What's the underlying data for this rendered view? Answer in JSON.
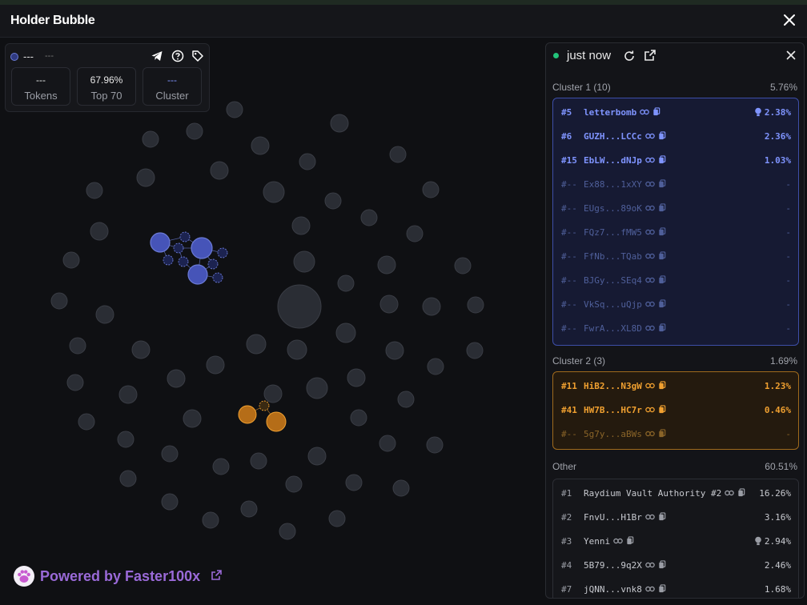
{
  "window": {
    "title": "Holder Bubble"
  },
  "summary": {
    "title": "---",
    "subtitle": "---",
    "stats": [
      {
        "value": "---",
        "label": "Tokens"
      },
      {
        "value": "67.96%",
        "label": "Top 70"
      },
      {
        "value": "---",
        "label": "Cluster"
      }
    ],
    "icons": [
      "telegram-icon",
      "help-icon",
      "tag-icon"
    ]
  },
  "footer": {
    "powered_prefix": "Powered by",
    "powered_brand": "Faster100x"
  },
  "panel": {
    "updated": "just now",
    "clusters": [
      {
        "name": "Cluster 1 (10)",
        "percent": "5.76%",
        "color": "#7f94ff",
        "rows": [
          {
            "rank": "#5",
            "name": "letterbomb",
            "percent": "2.38%",
            "bulb": true,
            "dim": false
          },
          {
            "rank": "#6",
            "name": "GUZH...LCCc",
            "percent": "2.36%",
            "bulb": false,
            "dim": false
          },
          {
            "rank": "#15",
            "name": "EbLW...dNJp",
            "percent": "1.03%",
            "bulb": false,
            "dim": false
          },
          {
            "rank": "#--",
            "name": "Ex88...1xXY",
            "percent": "-",
            "bulb": false,
            "dim": true
          },
          {
            "rank": "#--",
            "name": "EUgs...89oK",
            "percent": "-",
            "bulb": false,
            "dim": true
          },
          {
            "rank": "#--",
            "name": "FQz7...fMW5",
            "percent": "-",
            "bulb": false,
            "dim": true
          },
          {
            "rank": "#--",
            "name": "FfNb...TQab",
            "percent": "-",
            "bulb": false,
            "dim": true
          },
          {
            "rank": "#--",
            "name": "BJGy...SEq4",
            "percent": "-",
            "bulb": false,
            "dim": true
          },
          {
            "rank": "#--",
            "name": "VkSq...uQjp",
            "percent": "-",
            "bulb": false,
            "dim": true
          },
          {
            "rank": "#--",
            "name": "FwrA...XL8D",
            "percent": "-",
            "bulb": false,
            "dim": true
          }
        ]
      },
      {
        "name": "Cluster 2 (3)",
        "percent": "1.69%",
        "color": "#f0a030",
        "rows": [
          {
            "rank": "#11",
            "name": "HiB2...N3gW",
            "percent": "1.23%",
            "bulb": false,
            "dim": false
          },
          {
            "rank": "#41",
            "name": "HW7B...HC7r",
            "percent": "0.46%",
            "bulb": false,
            "dim": false
          },
          {
            "rank": "#--",
            "name": "5g7y...aBWs",
            "percent": "-",
            "bulb": false,
            "dim": true
          }
        ]
      },
      {
        "name": "Other",
        "percent": "60.51%",
        "color": "#c8cad0",
        "rows": [
          {
            "rank": "#1",
            "name": "Raydium Vault Authority #2",
            "percent": "16.26%",
            "bulb": false,
            "dim": false
          },
          {
            "rank": "#2",
            "name": "FnvU...H1Br",
            "percent": "3.16%",
            "bulb": false,
            "dim": false
          },
          {
            "rank": "#3",
            "name": "Yenni",
            "percent": "2.94%",
            "bulb": true,
            "dim": false
          },
          {
            "rank": "#4",
            "name": "5B79...9q2X",
            "percent": "2.46%",
            "bulb": false,
            "dim": false
          },
          {
            "rank": "#7",
            "name": "jQNN...vnk8",
            "percent": "1.68%",
            "bulb": false,
            "dim": false
          }
        ]
      }
    ]
  }
}
